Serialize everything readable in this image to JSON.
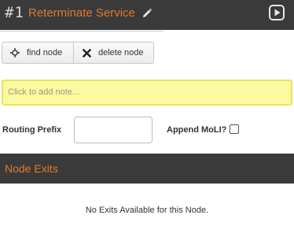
{
  "header": {
    "node_number": "#1",
    "title": "Reterminate Service",
    "edit_icon": "pencil-icon",
    "play_icon": "play-icon"
  },
  "toolbar": {
    "find_label": "find node",
    "find_icon": "crosshair-icon",
    "delete_label": "delete node",
    "delete_icon": "x-icon"
  },
  "note": {
    "placeholder": "Click to add note..."
  },
  "form": {
    "routing_prefix_label": "Routing Prefix",
    "routing_prefix_value": "",
    "append_moli_label": "Append MoLI?",
    "append_moli_checked": false
  },
  "exits": {
    "title": "Node Exits",
    "empty_message": "No Exits Available for this Node."
  },
  "colors": {
    "header_bg": "#3a3a3a",
    "accent": "#e07a2e",
    "note_bg": "#fcfaa0"
  }
}
